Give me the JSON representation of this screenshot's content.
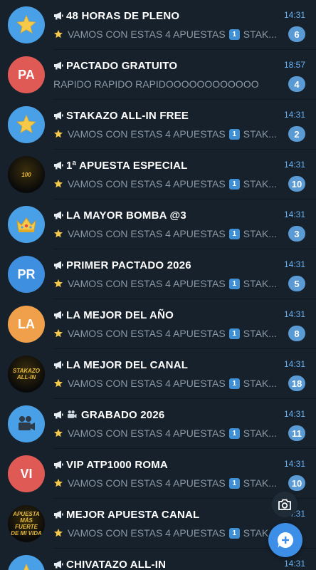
{
  "chats": [
    {
      "title": "48 HORAS DE PLENO",
      "time": "14:31",
      "preview": "VAMOS CON ESTAS 4 APUESTAS",
      "preview_tail": "STAK...",
      "keycap": "1",
      "badge": "6",
      "avatar": {
        "type": "star",
        "color": "#4aa0e6"
      }
    },
    {
      "title": "PACTADO GRATUITO",
      "time": "18:57",
      "preview": "RAPIDO RAPIDO RAPIDOOOOOOOOOOOO",
      "badge": "4",
      "avatar": {
        "type": "initials",
        "text": "PA",
        "color": "#e05a55"
      }
    },
    {
      "title": "STAKAZO ALL-IN FREE",
      "time": "14:31",
      "preview": "VAMOS CON ESTAS 4 APUESTAS",
      "preview_tail": "STAK...",
      "keycap": "1",
      "badge": "2",
      "avatar": {
        "type": "star",
        "color": "#4aa0e6"
      }
    },
    {
      "title": "1ª APUESTA ESPECIAL",
      "time": "14:31",
      "preview": "VAMOS CON ESTAS 4 APUESTAS",
      "preview_tail": "STAK...",
      "keycap": "1",
      "badge": "10",
      "avatar": {
        "type": "logo",
        "logo_text": "100",
        "color": "#111111"
      }
    },
    {
      "title": "LA MAYOR BOMBA @3",
      "time": "14:31",
      "preview": "VAMOS CON ESTAS 4 APUESTAS",
      "preview_tail": "STAK...",
      "keycap": "1",
      "badge": "3",
      "avatar": {
        "type": "crown",
        "color": "#4aa0e6"
      }
    },
    {
      "title": "PRIMER PACTADO 2026",
      "time": "14:31",
      "preview": "VAMOS CON ESTAS 4 APUESTAS",
      "preview_tail": "STAK...",
      "keycap": "1",
      "badge": "5",
      "avatar": {
        "type": "initials",
        "text": "PR",
        "color": "#3e8fe0"
      }
    },
    {
      "title": "LA MEJOR DEL AÑO",
      "time": "14:31",
      "preview": "VAMOS CON ESTAS 4 APUESTAS",
      "preview_tail": "STAK...",
      "keycap": "1",
      "badge": "8",
      "avatar": {
        "type": "initials",
        "text": "LA",
        "color": "#f0a04b"
      }
    },
    {
      "title": "LA MEJOR DEL CANAL",
      "time": "14:31",
      "preview": "VAMOS CON ESTAS 4 APUESTAS",
      "preview_tail": "STAK...",
      "keycap": "1",
      "badge": "18",
      "avatar": {
        "type": "logo",
        "logo_text": "STAKAZO ALL-IN",
        "color": "#111111"
      }
    },
    {
      "title": "GRABADO 2026",
      "title_icon": "movie-camera-icon",
      "time": "14:31",
      "preview": "VAMOS CON ESTAS 4 APUESTAS",
      "preview_tail": "STAK...",
      "keycap": "1",
      "badge": "11",
      "avatar": {
        "type": "camera",
        "color": "#4aa0e6"
      }
    },
    {
      "title": "VIP ATP1000 ROMA",
      "time": "14:31",
      "preview": "VAMOS CON ESTAS 4 APUESTAS",
      "preview_tail": "STAK...",
      "keycap": "1",
      "badge": "10",
      "avatar": {
        "type": "initials",
        "text": "VI",
        "color": "#e05a55"
      }
    },
    {
      "title": "MEJOR APUESTA CANAL",
      "time": "14:31",
      "preview": "VAMOS CON ESTAS 4 APUESTAS",
      "preview_tail": "STAK",
      "keycap": "1",
      "badge": "",
      "avatar": {
        "type": "logo",
        "logo_text": "APUESTA MÁS FUERTE DE MI VIDA",
        "color": "#111111"
      }
    },
    {
      "title": "CHIVATAZO ALL-IN",
      "time": "14:31",
      "preview": "",
      "badge": "",
      "avatar": {
        "type": "star",
        "color": "#4aa0e6"
      }
    }
  ],
  "colors": {
    "background": "#17212b",
    "accent": "#6ab3f3",
    "badge": "#5b9bd5",
    "fab": "#3c8ee7"
  },
  "icons": {
    "row_title": "megaphone-icon",
    "preview": "star-icon",
    "camera_button": "camera-icon",
    "fab": "new-message-icon"
  }
}
